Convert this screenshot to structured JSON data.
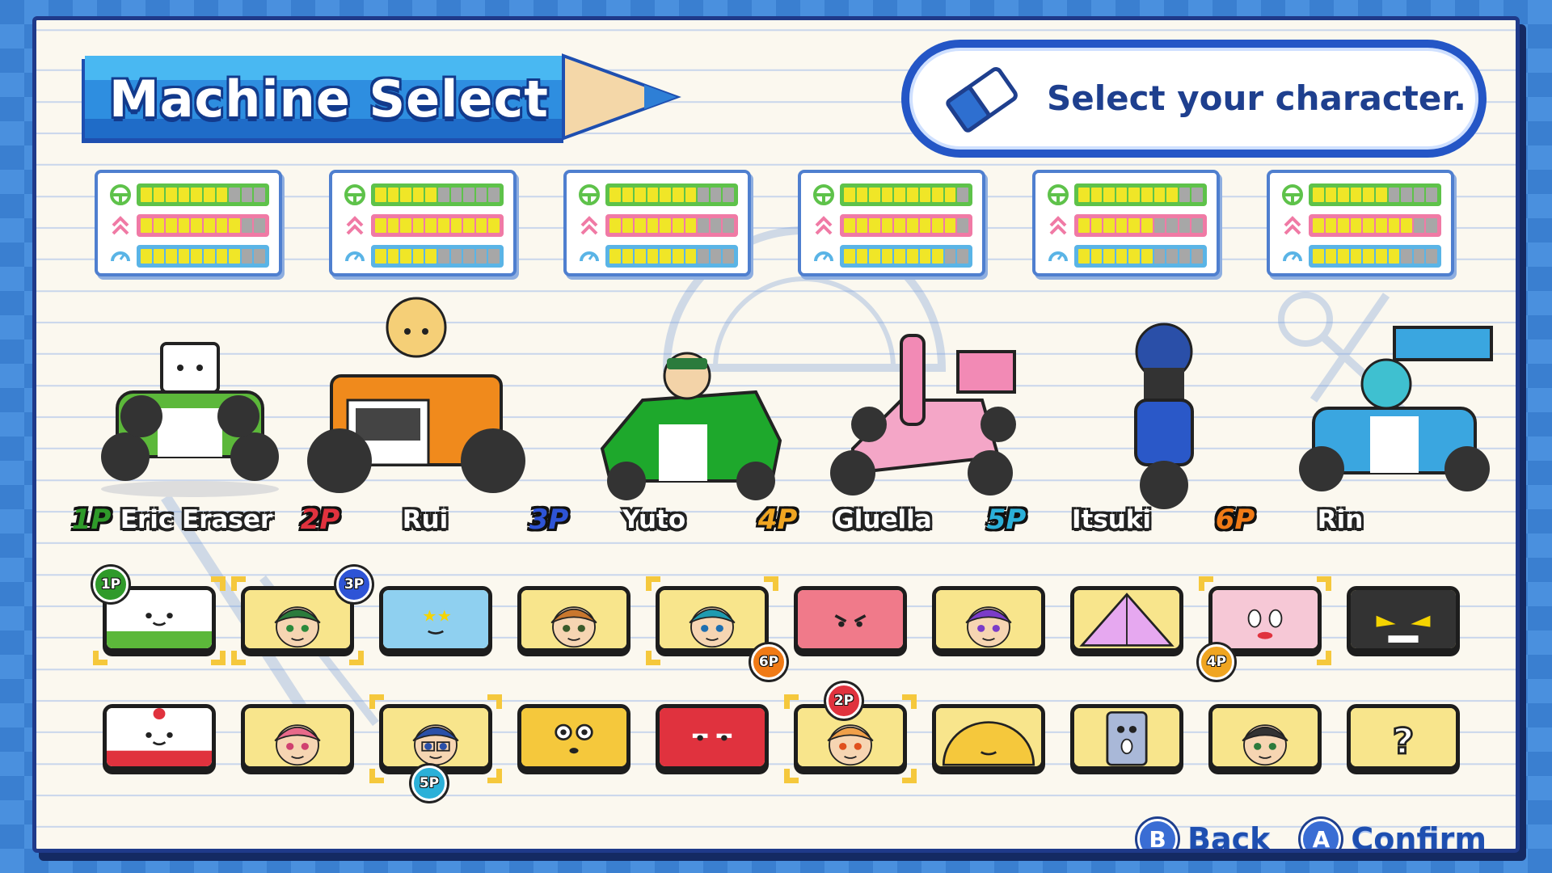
{
  "title": "Machine Select",
  "instruction": "Select your character.",
  "colors": {
    "accent_blue": "#2456c6",
    "pencil_blue": "#2e73d6",
    "paper": "#fbf8ef",
    "stat_on": "#f0e627",
    "stat_off": "#a7a7a7"
  },
  "stat_icons": [
    "steering-wheel-icon",
    "acceleration-chevron-icon",
    "speedometer-icon"
  ],
  "machines": [
    {
      "stats": [
        7,
        8,
        8
      ],
      "kart_color": "#5cb83a"
    },
    {
      "stats": [
        5,
        10,
        5
      ],
      "kart_color": "#f08a1c"
    },
    {
      "stats": [
        7,
        7,
        7
      ],
      "kart_color": "#1ea82c"
    },
    {
      "stats": [
        9,
        9,
        8
      ],
      "kart_color": "#f28ab5"
    },
    {
      "stats": [
        8,
        6,
        6
      ],
      "kart_color": "#2a58c8"
    },
    {
      "stats": [
        6,
        8,
        7
      ],
      "kart_color": "#3aa6e0"
    }
  ],
  "players": [
    {
      "badge": "1P",
      "name": "Eric Eraser",
      "color": "#2f9a2a"
    },
    {
      "badge": "2P",
      "name": "Rui",
      "color": "#e0323e"
    },
    {
      "badge": "3P",
      "name": "Yuto",
      "color": "#2e54d6"
    },
    {
      "badge": "4P",
      "name": "Gluella",
      "color": "#f0a521"
    },
    {
      "badge": "5P",
      "name": "Itsuki",
      "color": "#2bb0d8"
    },
    {
      "badge": "6P",
      "name": "Rin",
      "color": "#f07a16"
    }
  ],
  "roster_rows": [
    [
      {
        "portrait": "eraser-face",
        "pin": "1P",
        "pin_color": "#2f9a2a"
      },
      {
        "portrait": "goggles-boy-face",
        "pin": "3P",
        "pin_color": "#2e54d6"
      },
      {
        "portrait": "ruler-face",
        "pin": "",
        "pin_color": ""
      },
      {
        "portrait": "brown-hair-boy-face",
        "pin": "",
        "pin_color": ""
      },
      {
        "portrait": "teal-hair-girl-face",
        "pin": "6P",
        "pin_color": "#f07a16"
      },
      {
        "portrait": "scissors-face",
        "pin": "",
        "pin_color": ""
      },
      {
        "portrait": "purple-cap-girl-face",
        "pin": "",
        "pin_color": ""
      },
      {
        "portrait": "triangle-ruler-face",
        "pin": "",
        "pin_color": ""
      },
      {
        "portrait": "glue-stick-face",
        "pin": "4P",
        "pin_color": "#f0a521"
      },
      {
        "portrait": "stapler-face",
        "pin": "",
        "pin_color": ""
      }
    ],
    [
      {
        "portrait": "cake-eraser-face",
        "pin": "",
        "pin_color": ""
      },
      {
        "portrait": "pink-hair-girl-face",
        "pin": "",
        "pin_color": ""
      },
      {
        "portrait": "glasses-headphones-boy-face",
        "pin": "5P",
        "pin_color": "#2bb0d8"
      },
      {
        "portrait": "yellow-pencil-case-face",
        "pin": "",
        "pin_color": ""
      },
      {
        "portrait": "red-box-face",
        "pin": "",
        "pin_color": ""
      },
      {
        "portrait": "orange-hair-girl-face",
        "pin": "2P",
        "pin_color": "#e0323e"
      },
      {
        "portrait": "protractor-face",
        "pin": "",
        "pin_color": ""
      },
      {
        "portrait": "sharpener-face",
        "pin": "",
        "pin_color": ""
      },
      {
        "portrait": "spiky-hair-boy-face",
        "pin": "",
        "pin_color": ""
      },
      {
        "portrait": "random-question-mark",
        "pin": "",
        "pin_color": ""
      }
    ]
  ],
  "random_glyph": "?",
  "controls": {
    "back_key": "B",
    "back_label": "Back",
    "confirm_key": "A",
    "confirm_label": "Confirm"
  }
}
